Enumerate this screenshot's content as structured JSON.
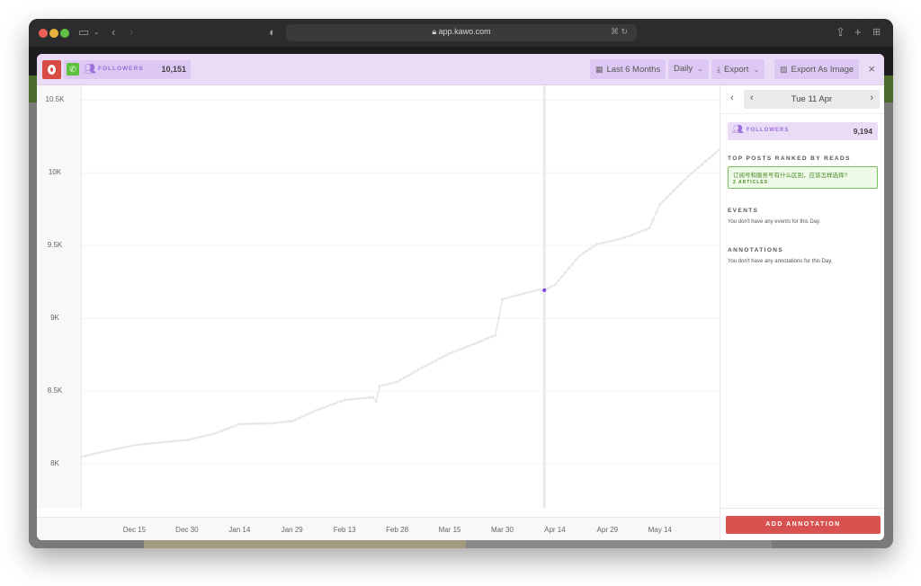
{
  "browser": {
    "url": "app.kawo.com",
    "icons": [
      "sidebar-icon",
      "chevron-down-icon",
      "back-icon",
      "forward-icon",
      "privacy-shield-icon",
      "lock-icon",
      "translate-icon",
      "reload-icon",
      "share-icon",
      "new-tab-icon",
      "tab-overview-icon"
    ]
  },
  "header": {
    "metric_label": "FOLLOWERS",
    "metric_value": "10,151",
    "range_label": "Last 6 Months",
    "interval_label": "Daily",
    "export_label": "Export",
    "export_image_label": "Export As Image",
    "close_symbol": "×"
  },
  "side": {
    "date": "Tue 11 Apr",
    "followers_label": "FOLLOWERS",
    "followers_value": "9,194",
    "top_posts_title": "TOP POSTS RANKED BY READS",
    "top_post_title": "订阅号和服务号有什么区别，应该怎样选择?",
    "top_post_count": "2 ARTICLES",
    "events_title": "EVENTS",
    "events_text": "You don't have any events for this Day.",
    "annotations_title": "ANNOTATIONS",
    "annotations_text": "You don't have any annotations for this Day.",
    "add_annotation_label": "ADD ANNOTATION"
  },
  "colors": {
    "accent_purple": "#9b6ddb",
    "header_bg": "#eadbf7",
    "brand_red": "#d84b45",
    "wechat_green": "#5cc23d",
    "line_color": "#e6e6e6",
    "cursor_point": "#7b3fe4"
  },
  "chart_data": {
    "type": "line",
    "title": "",
    "xlabel": "",
    "ylabel": "Followers",
    "ylim": [
      7700,
      10600
    ],
    "yticks": [
      8000,
      8500,
      9000,
      9500,
      10000,
      10500
    ],
    "ytick_labels": [
      "8K",
      "8.5K",
      "9K",
      "9.5K",
      "10K",
      "10.5K"
    ],
    "xtick_labels": [
      "Dec 15",
      "Dec 30",
      "Jan 14",
      "Jan 29",
      "Feb 13",
      "Feb 28",
      "Mar 15",
      "Mar 30",
      "Apr 14",
      "Apr 29",
      "May 14"
    ],
    "xtick_days": [
      15,
      30,
      45,
      60,
      75,
      90,
      105,
      120,
      135,
      150,
      165
    ],
    "xlim_days": [
      0,
      182
    ],
    "grid": true,
    "legend": "none",
    "selected": {
      "label": "Tue 11 Apr",
      "day": 132,
      "value": 9194
    },
    "series": [
      {
        "name": "Followers",
        "points": [
          [
            0,
            8050
          ],
          [
            7,
            8090
          ],
          [
            15,
            8130
          ],
          [
            23,
            8150
          ],
          [
            30,
            8165
          ],
          [
            38,
            8210
          ],
          [
            45,
            8275
          ],
          [
            54,
            8280
          ],
          [
            60,
            8295
          ],
          [
            67,
            8370
          ],
          [
            75,
            8440
          ],
          [
            83,
            8460
          ],
          [
            84,
            8430
          ],
          [
            85,
            8535
          ],
          [
            90,
            8565
          ],
          [
            97,
            8660
          ],
          [
            105,
            8760
          ],
          [
            113,
            8835
          ],
          [
            118,
            8885
          ],
          [
            119,
            9000
          ],
          [
            120,
            9130
          ],
          [
            122,
            9145
          ],
          [
            130,
            9195
          ],
          [
            132,
            9194
          ],
          [
            135,
            9230
          ],
          [
            142,
            9430
          ],
          [
            147,
            9510
          ],
          [
            150,
            9525
          ],
          [
            155,
            9555
          ],
          [
            162,
            9620
          ],
          [
            165,
            9785
          ],
          [
            173,
            9975
          ],
          [
            182,
            10160
          ]
        ]
      }
    ]
  }
}
